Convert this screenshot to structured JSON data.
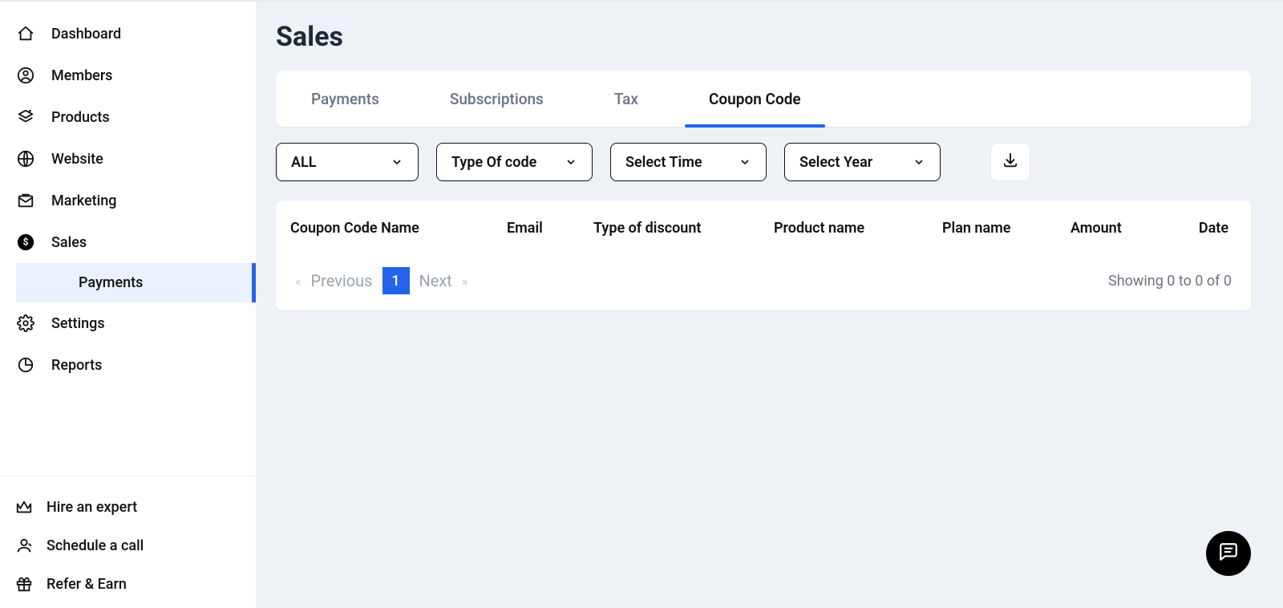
{
  "sidebar": {
    "items": [
      {
        "label": "Dashboard"
      },
      {
        "label": "Members"
      },
      {
        "label": "Products"
      },
      {
        "label": "Website"
      },
      {
        "label": "Marketing"
      },
      {
        "label": "Sales"
      },
      {
        "label": "Settings"
      },
      {
        "label": "Reports"
      }
    ],
    "sub": {
      "payments": "Payments"
    },
    "footer": [
      {
        "label": "Hire an expert"
      },
      {
        "label": "Schedule a call"
      },
      {
        "label": "Refer & Earn"
      }
    ]
  },
  "page": {
    "title": "Sales"
  },
  "tabs": [
    {
      "label": "Payments"
    },
    {
      "label": "Subscriptions"
    },
    {
      "label": "Tax"
    },
    {
      "label": "Coupon Code"
    }
  ],
  "filters": [
    {
      "label": "ALL"
    },
    {
      "label": "Type Of code"
    },
    {
      "label": "Select Time"
    },
    {
      "label": "Select Year"
    }
  ],
  "table": {
    "headers": [
      "Coupon Code Name",
      "Email",
      "Type of discount",
      "Product name",
      "Plan name",
      "Amount",
      "Date"
    ]
  },
  "pagination": {
    "prev": "Previous",
    "next": "Next",
    "current": "1",
    "showing": "Showing 0 to 0 of 0"
  }
}
